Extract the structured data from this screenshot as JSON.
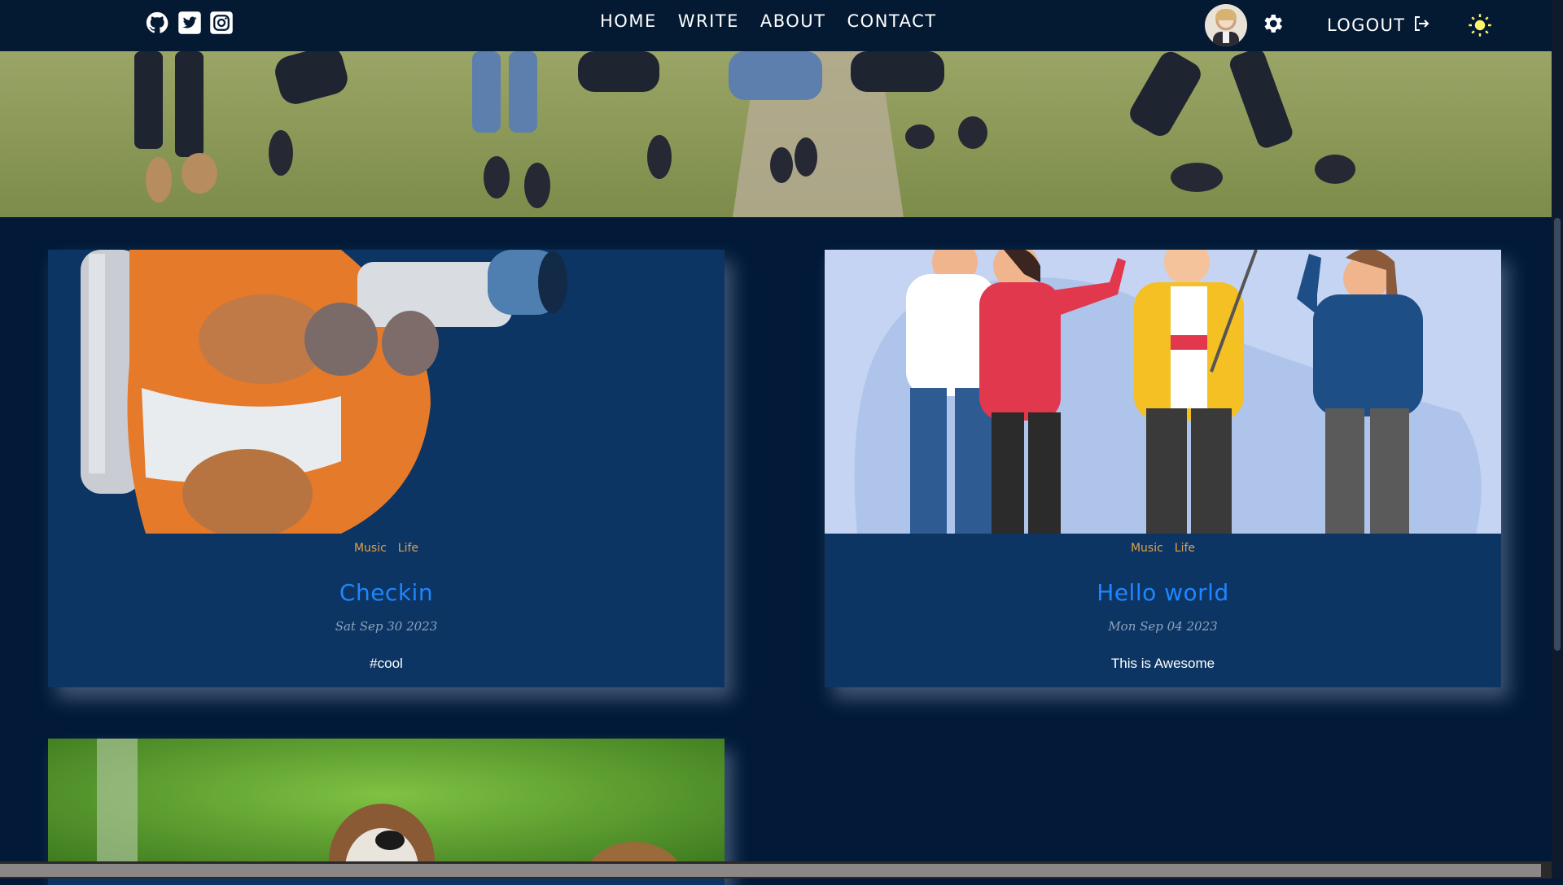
{
  "nav": {
    "social_icons": [
      "github-icon",
      "twitter-icon",
      "instagram-icon"
    ],
    "links": [
      "HOME",
      "WRITE",
      "ABOUT",
      "CONTACT"
    ],
    "logout_label": "LOGOUT"
  },
  "posts": [
    {
      "categories": [
        "Music",
        "Life"
      ],
      "title": "Checkin",
      "date": "Sat Sep 30 2023",
      "description": "#cool",
      "image": "astronaut-teddy-with-camera"
    },
    {
      "categories": [
        "Music",
        "Life"
      ],
      "title": "Hello world",
      "date": "Mon Sep 04 2023",
      "description": "This is Awesome",
      "image": "friends-taking-selfie-illustration"
    },
    {
      "image": "sparrows-on-green-background"
    }
  ],
  "colors": {
    "background": "#021a38",
    "navbar": "#041a33",
    "card": "#0c3563",
    "title": "#1f86ff",
    "category": "#e0a14a"
  }
}
